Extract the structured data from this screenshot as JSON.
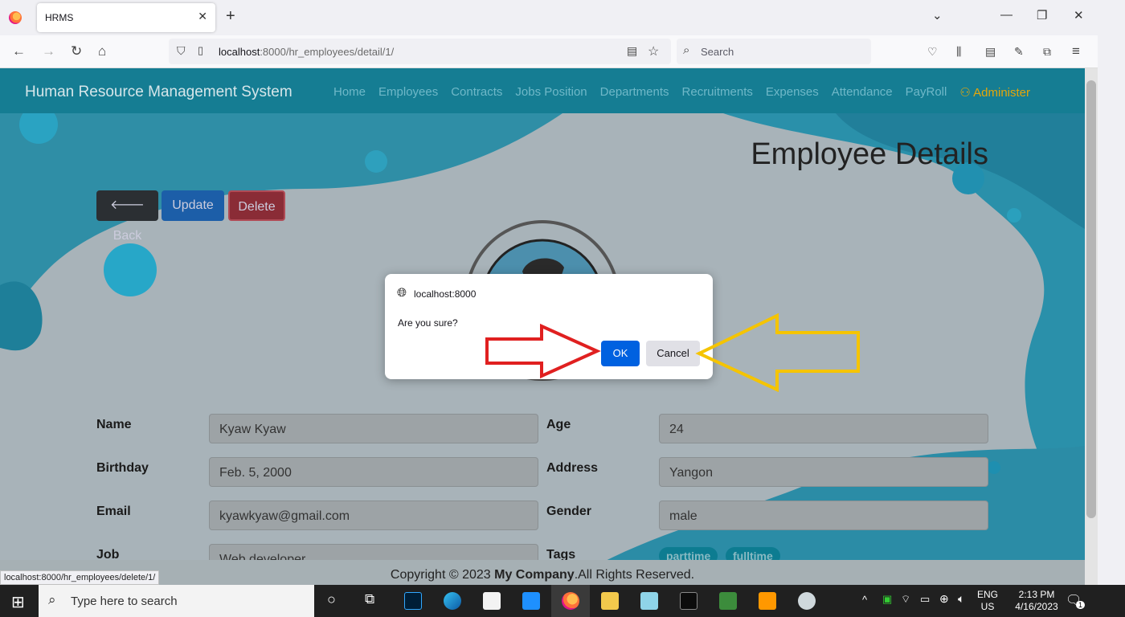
{
  "browser": {
    "tab_title": "HRMS",
    "url_host": "localhost",
    "url_rest": ":8000/hr_employees/detail/1/",
    "search_placeholder": "Search",
    "status_url": "localhost:8000/hr_employees/delete/1/"
  },
  "site": {
    "brand": "Human Resource Management System",
    "menu": [
      "Home",
      "Employees",
      "Contracts",
      "Jobs Position",
      "Departments",
      "Recruitments",
      "Expenses",
      "Attendance",
      "PayRoll"
    ],
    "admin_label": "Administer",
    "page_title": "Employee Details",
    "buttons": {
      "back": "Back",
      "update": "Update",
      "delete": "Delete"
    }
  },
  "employee": {
    "labels": {
      "name": "Name",
      "age": "Age",
      "birthday": "Birthday",
      "address": "Address",
      "email": "Email",
      "gender": "Gender",
      "job": "Job",
      "tags": "Tags"
    },
    "values": {
      "name": "Kyaw Kyaw",
      "age": "24",
      "birthday": "Feb. 5, 2000",
      "address": "Yangon",
      "email": "kyawkyaw@gmail.com",
      "gender": "male",
      "job": "Web developer"
    },
    "tags": [
      "parttime",
      "fulltime"
    ]
  },
  "footer": {
    "prefix": "Copyright © 2023 ",
    "company": "My Company",
    "suffix": ".All Rights Reserved."
  },
  "dialog": {
    "origin": "localhost:8000",
    "message": "Are you sure?",
    "ok": "OK",
    "cancel": "Cancel"
  },
  "taskbar": {
    "search_placeholder": "Type here to search",
    "lang_top": "ENG",
    "lang_bottom": "US",
    "time": "2:13 PM",
    "date": "4/16/2023",
    "notification_count": "1"
  },
  "colors": {
    "navbar": "#157d93",
    "delete": "#a3303c",
    "update": "#1565c0",
    "ok": "#0061e0",
    "red_arrow": "#e02020",
    "yellow_arrow": "#f5c400"
  }
}
